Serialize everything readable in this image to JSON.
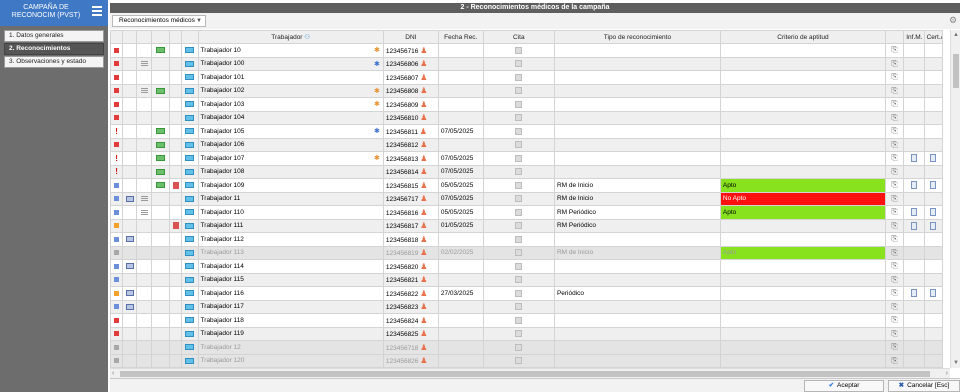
{
  "sidebar": {
    "title": "CAMPAÑA DE RECONOCIM (PVST)",
    "items": [
      {
        "label": "1. Datos generales"
      },
      {
        "label": "2. Reconocimientos"
      },
      {
        "label": "3. Observaciones y estado"
      }
    ]
  },
  "window": {
    "title": "2 - Reconocimientos médicos de la campaña"
  },
  "toolbar": {
    "dropdown": "Reconocimientos médicos"
  },
  "table": {
    "columns": [
      "Trabajador",
      "DNI",
      "Fecha Rec.",
      "Cita",
      "Tipo de reconocimiento",
      "Criterio de aptitud",
      "Inf.M.",
      "Cert.A"
    ],
    "rows": [
      {
        "s": "red",
        "pr": "",
        "ln": "",
        "p1": "PP",
        "rb": "",
        "p2": "x",
        "name": "Trabajador 10",
        "wi": "orange",
        "dni": "123456716",
        "date": "",
        "tipo": "",
        "crit": "",
        "critClass": "",
        "docs": "00",
        "state": ""
      },
      {
        "s": "red",
        "pr": "",
        "ln": "y",
        "p1": "",
        "rb": "",
        "p2": "x",
        "name": "Trabajador 100",
        "wi": "blue",
        "dni": "123456806",
        "date": "",
        "tipo": "",
        "crit": "",
        "critClass": "",
        "docs": "00",
        "state": ""
      },
      {
        "s": "red",
        "pr": "",
        "ln": "",
        "p1": "",
        "rb": "",
        "p2": "x",
        "name": "Trabajador 101",
        "wi": "",
        "dni": "123456807",
        "date": "",
        "tipo": "",
        "crit": "",
        "critClass": "",
        "docs": "00",
        "state": ""
      },
      {
        "s": "red",
        "pr": "",
        "ln": "y",
        "p1": "PP",
        "rb": "",
        "p2": "x",
        "name": "Trabajador 102",
        "wi": "orange",
        "dni": "123456808",
        "date": "",
        "tipo": "",
        "crit": "",
        "critClass": "",
        "docs": "00",
        "state": ""
      },
      {
        "s": "red",
        "pr": "",
        "ln": "",
        "p1": "",
        "rb": "",
        "p2": "x",
        "name": "Trabajador 103",
        "wi": "orange",
        "dni": "123456809",
        "date": "",
        "tipo": "",
        "crit": "",
        "critClass": "",
        "docs": "00",
        "state": ""
      },
      {
        "s": "red",
        "pr": "",
        "ln": "",
        "p1": "",
        "rb": "",
        "p2": "x",
        "name": "Trabajador 104",
        "wi": "",
        "dni": "123456810",
        "date": "",
        "tipo": "",
        "crit": "",
        "critClass": "",
        "docs": "00",
        "state": ""
      },
      {
        "s": "excl",
        "pr": "",
        "ln": "",
        "p1": "PP",
        "rb": "",
        "p2": "x",
        "name": "Trabajador 105",
        "wi": "blue",
        "dni": "123456811",
        "date": "07/05/2025",
        "tipo": "",
        "crit": "",
        "critClass": "",
        "docs": "00",
        "state": ""
      },
      {
        "s": "red",
        "pr": "",
        "ln": "",
        "p1": "PP",
        "rb": "",
        "p2": "x",
        "name": "Trabajador 106",
        "wi": "",
        "dni": "123456812",
        "date": "",
        "tipo": "",
        "crit": "",
        "critClass": "",
        "docs": "00",
        "state": ""
      },
      {
        "s": "excl",
        "pr": "",
        "ln": "",
        "p1": "PP",
        "rb": "",
        "p2": "x",
        "name": "Trabajador 107",
        "wi": "orange",
        "dni": "123456813",
        "date": "07/05/2025",
        "tipo": "",
        "crit": "",
        "critClass": "",
        "docs": "11",
        "state": ""
      },
      {
        "s": "excl",
        "pr": "",
        "ln": "",
        "p1": "PP",
        "rb": "",
        "p2": "x",
        "name": "Trabajador 108",
        "wi": "",
        "dni": "123456814",
        "date": "07/05/2025",
        "tipo": "",
        "crit": "",
        "critClass": "",
        "docs": "00",
        "state": ""
      },
      {
        "s": "blue",
        "pr": "",
        "ln": "",
        "p1": "PP",
        "rb": "y",
        "p2": "x",
        "name": "Trabajador 109",
        "wi": "",
        "dni": "123456815",
        "date": "05/05/2025",
        "tipo": "RM de Inicio",
        "crit": "Apto",
        "critClass": "apto",
        "docs": "11",
        "state": ""
      },
      {
        "s": "blue",
        "pr": "y",
        "ln": "y",
        "p1": "",
        "rb": "",
        "p2": "x",
        "name": "Trabajador 11",
        "wi": "",
        "dni": "123456717",
        "date": "07/05/2025",
        "tipo": "RM de Inicio",
        "crit": "No Apto",
        "critClass": "noapto",
        "docs": "00",
        "state": ""
      },
      {
        "s": "blue",
        "pr": "",
        "ln": "y",
        "p1": "",
        "rb": "",
        "p2": "x",
        "name": "Trabajador 110",
        "wi": "",
        "dni": "123456816",
        "date": "05/05/2025",
        "tipo": "RM Periódico",
        "crit": "Apto",
        "critClass": "apto",
        "docs": "11",
        "state": ""
      },
      {
        "s": "orange",
        "pr": "",
        "ln": "",
        "p1": "",
        "rb": "y",
        "p2": "x",
        "name": "Trabajador 111",
        "wi": "",
        "dni": "123456817",
        "date": "01/05/2025",
        "tipo": "RM Periódico",
        "crit": "",
        "critClass": "",
        "docs": "11",
        "state": ""
      },
      {
        "s": "blue",
        "pr": "y",
        "ln": "",
        "p1": "",
        "rb": "",
        "p2": "x",
        "name": "Trabajador 112",
        "wi": "",
        "dni": "123456818",
        "date": "",
        "tipo": "",
        "crit": "",
        "critClass": "",
        "docs": "00",
        "state": ""
      },
      {
        "s": "grey",
        "pr": "",
        "ln": "",
        "p1": "",
        "rb": "",
        "p2": "x",
        "name": "Trabajador 113",
        "wi": "",
        "dni": "123456819",
        "date": "02/02/2025",
        "tipo": "RM de Inicio",
        "crit": "Apto",
        "critClass": "apto",
        "docs": "00",
        "state": "disabled"
      },
      {
        "s": "blue",
        "pr": "y",
        "ln": "",
        "p1": "",
        "rb": "",
        "p2": "x",
        "name": "Trabajador 114",
        "wi": "",
        "dni": "123456820",
        "date": "",
        "tipo": "",
        "crit": "",
        "critClass": "",
        "docs": "00",
        "state": ""
      },
      {
        "s": "blue",
        "pr": "",
        "ln": "",
        "p1": "",
        "rb": "",
        "p2": "x",
        "name": "Trabajador 115",
        "wi": "",
        "dni": "123456821",
        "date": "",
        "tipo": "",
        "crit": "",
        "critClass": "",
        "docs": "00",
        "state": ""
      },
      {
        "s": "orange",
        "pr": "y",
        "ln": "",
        "p1": "",
        "rb": "",
        "p2": "x",
        "name": "Trabajador 116",
        "wi": "",
        "dni": "123456822",
        "date": "27/03/2025",
        "tipo": "Periódico",
        "crit": "",
        "critClass": "",
        "docs": "11",
        "state": ""
      },
      {
        "s": "blue",
        "pr": "y",
        "ln": "",
        "p1": "",
        "rb": "",
        "p2": "x",
        "name": "Trabajador 117",
        "wi": "",
        "dni": "123456823",
        "date": "",
        "tipo": "",
        "crit": "",
        "critClass": "",
        "docs": "00",
        "state": ""
      },
      {
        "s": "red",
        "pr": "",
        "ln": "",
        "p1": "",
        "rb": "",
        "p2": "x",
        "name": "Trabajador 118",
        "wi": "",
        "dni": "123456824",
        "date": "",
        "tipo": "",
        "crit": "",
        "critClass": "",
        "docs": "00",
        "state": ""
      },
      {
        "s": "red",
        "pr": "",
        "ln": "",
        "p1": "",
        "rb": "",
        "p2": "x",
        "name": "Trabajador 119",
        "wi": "",
        "dni": "123456825",
        "date": "",
        "tipo": "",
        "crit": "",
        "critClass": "",
        "docs": "00",
        "state": ""
      },
      {
        "s": "grey",
        "pr": "",
        "ln": "",
        "p1": "",
        "rb": "",
        "p2": "x",
        "name": "Trabajador 12",
        "wi": "",
        "dni": "123456718",
        "date": "",
        "tipo": "",
        "crit": "",
        "critClass": "",
        "docs": "00",
        "state": "disabled"
      },
      {
        "s": "grey",
        "pr": "",
        "ln": "",
        "p1": "",
        "rb": "",
        "p2": "x",
        "name": "Trabajador 120",
        "wi": "",
        "dni": "123456826",
        "date": "",
        "tipo": "",
        "crit": "",
        "critClass": "",
        "docs": "00",
        "state": "disabled"
      }
    ]
  },
  "icons": {
    "excl": "!",
    "person": "♟",
    "clip": "⊘",
    "pp": "PP"
  },
  "footer": {
    "accept": "Aceptar",
    "cancel": "Cancelar [Esc]"
  },
  "colors": {
    "apto": "#88e21e",
    "noapto": "#ff1010",
    "accent": "#3f78c4"
  }
}
